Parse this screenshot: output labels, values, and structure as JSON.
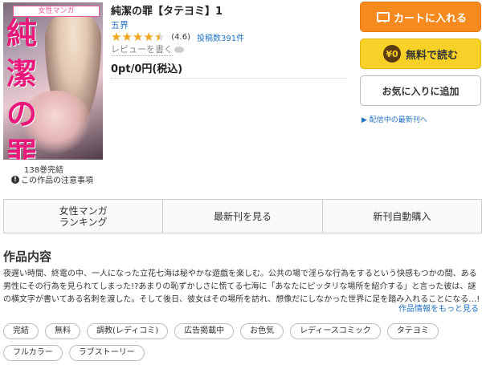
{
  "book": {
    "genre_tag": "女性マンガ",
    "cover_title": "純潔の罪",
    "volumes": "138巻完結",
    "caution": "この作品の注意事項",
    "title": "純潔の罪【タテヨミ】1",
    "author": "五界",
    "rating_value": "(4.6)",
    "rating": 4.6,
    "reviews": "投稿数391件",
    "write_review": "レビューを書く",
    "price": "0pt/0円(税込)"
  },
  "actions": {
    "cart": "カートに入れる",
    "free_icon": "¥0",
    "free": "無料で読む",
    "favorite": "お気に入りに追加",
    "new_release": "▶ 配信中の最新刊へ"
  },
  "tabs": [
    {
      "label": "女性マンガ\nランキング"
    },
    {
      "label": "最新刊を見る"
    },
    {
      "label": "新刊自動購入"
    }
  ],
  "description": {
    "heading": "作品内容",
    "text": "夜遅い時間、終電の中、一人になった立花七海は秘やかな遊戯を楽しむ。公共の場で淫らな行為をするという快感もつかの間、ある男性にその行為を見られてしまった!?あまりの恥ずかしさに慌てる七海に「あなたにピッタリな場所を紹介する」と言った彼は、謎の横文字が書いてある名刺を渡した。そして後日、彼女はその場所を訪れ、想像だにしなかった世界に足を踏み入れることになる…!",
    "more": "作品情報をもっと見る"
  },
  "tags": [
    "完結",
    "無料",
    "調教(レディコミ)",
    "広告掲載中",
    "お色気",
    "レディースコミック",
    "タテヨミ",
    "フルカラー",
    "ラブストーリー"
  ]
}
